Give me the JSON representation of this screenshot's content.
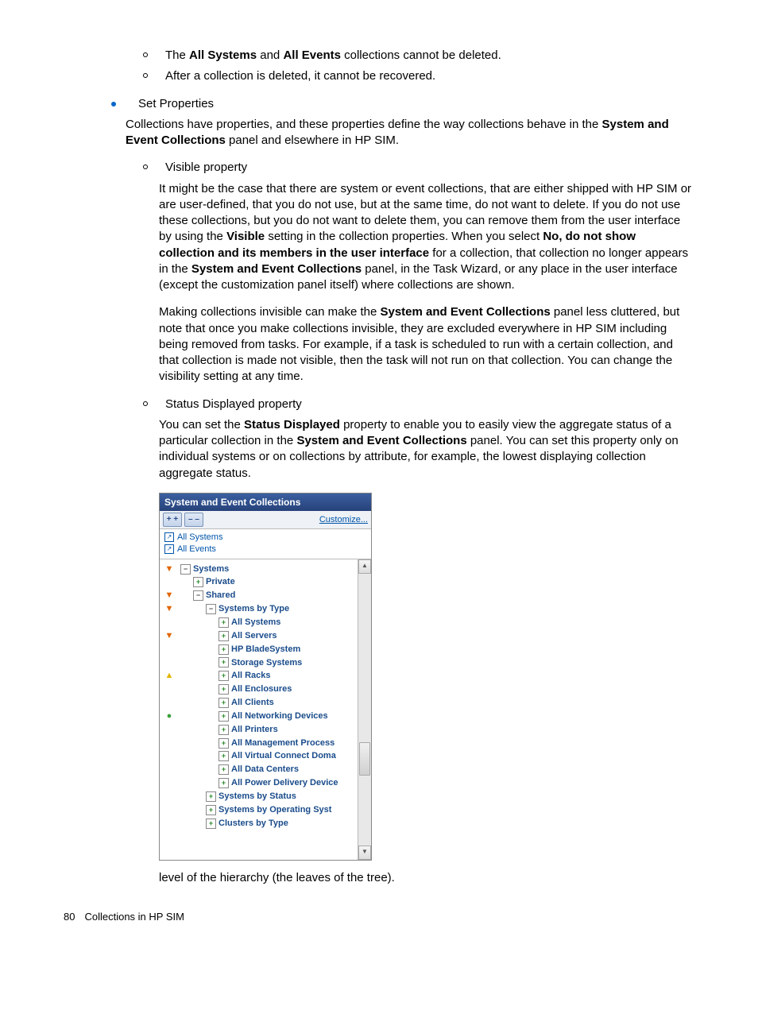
{
  "body": {
    "sub_a": {
      "pre": "The ",
      "b1": "All Systems",
      "mid": " and ",
      "b2": "All Events",
      "post": " collections cannot be deleted."
    },
    "sub_b": "After a collection is deleted, it cannot be recovered.",
    "set_props_title": "Set Properties",
    "set_props_para": {
      "pre": "Collections have properties, and these properties define the way collections behave in the ",
      "b": "System and Event Collections",
      "post": " panel and elsewhere in HP SIM."
    },
    "visible_title": "Visible property",
    "visible_p1": {
      "s1": "It might be the case that there are system or event collections, that are either shipped with HP SIM or are user-defined, that you do not use, but at the same time, do not want to delete. If you do not use these collections, but you do not want to delete them, you can remove them from the user interface by using the ",
      "b1": "Visible",
      "s2": " setting in the collection properties. When you select ",
      "b2": "No, do not show collection and its members in the user interface",
      "s3": " for a collection, that collection no longer appears in the ",
      "b3": "System and Event Collections",
      "s4": " panel, in the Task Wizard, or any place in the user interface (except the customization panel itself) where collections are shown."
    },
    "visible_p2": {
      "s1": "Making collections invisible can make the ",
      "b1": "System and Event Collections",
      "s2": " panel less cluttered, but note that once you make collections invisible, they are excluded everywhere in HP SIM including being removed from tasks. For example, if a task is scheduled to run with a certain collection, and that collection is made not visible, then the task will not run on that collection. You can change the visibility setting at any time."
    },
    "status_title": "Status Displayed property",
    "status_p1": {
      "s1": "You can set the ",
      "b1": "Status Displayed",
      "s2": " property to enable you to easily view the aggregate status of a particular collection in the ",
      "b2": "System and Event Collections",
      "s3": " panel. You can set this property only on individual systems or on collections by attribute, for example, the lowest displaying collection aggregate status."
    },
    "after_panel": "level of the hierarchy (the leaves of the tree)."
  },
  "panel": {
    "title": "System and Event Collections",
    "btn_expand": "+ +",
    "btn_collapse": "– –",
    "customize": "Customize...",
    "quicklinks": [
      "All Systems",
      "All Events"
    ],
    "tree": [
      {
        "status": "critical",
        "depth": 0,
        "exp": "-",
        "label": "Systems"
      },
      {
        "status": "",
        "depth": 1,
        "exp": "+",
        "label": "Private"
      },
      {
        "status": "critical",
        "depth": 1,
        "exp": "-",
        "label": "Shared"
      },
      {
        "status": "critical",
        "depth": 2,
        "exp": "-",
        "label": "Systems by Type"
      },
      {
        "status": "",
        "depth": 3,
        "exp": "+",
        "label": "All Systems"
      },
      {
        "status": "critical",
        "depth": 3,
        "exp": "+",
        "label": "All Servers"
      },
      {
        "status": "",
        "depth": 3,
        "exp": "+",
        "label": "HP BladeSystem"
      },
      {
        "status": "",
        "depth": 3,
        "exp": "+",
        "label": "Storage Systems"
      },
      {
        "status": "warn",
        "depth": 3,
        "exp": "+",
        "label": "All Racks"
      },
      {
        "status": "",
        "depth": 3,
        "exp": "+",
        "label": "All Enclosures"
      },
      {
        "status": "",
        "depth": 3,
        "exp": "+",
        "label": "All Clients"
      },
      {
        "status": "ok",
        "depth": 3,
        "exp": "+",
        "label": "All Networking Devices"
      },
      {
        "status": "",
        "depth": 3,
        "exp": "+",
        "label": "All Printers"
      },
      {
        "status": "",
        "depth": 3,
        "exp": "+",
        "label": "All Management Process"
      },
      {
        "status": "",
        "depth": 3,
        "exp": "+",
        "label": "All Virtual Connect Doma"
      },
      {
        "status": "",
        "depth": 3,
        "exp": "+",
        "label": "All Data Centers"
      },
      {
        "status": "",
        "depth": 3,
        "exp": "+",
        "label": "All Power Delivery Device"
      },
      {
        "status": "",
        "depth": 2,
        "exp": "+",
        "label": "Systems by Status"
      },
      {
        "status": "",
        "depth": 2,
        "exp": "+",
        "label": "Systems by Operating Syst"
      },
      {
        "status": "",
        "depth": 2,
        "exp": "+",
        "label": "Clusters by Type"
      }
    ]
  },
  "footer": {
    "page": "80",
    "runhead": "Collections in HP SIM"
  }
}
